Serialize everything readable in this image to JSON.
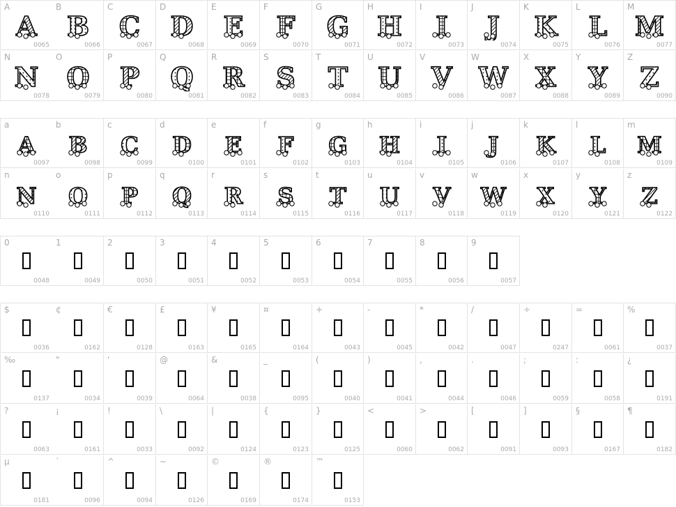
{
  "sections": [
    {
      "id": "uppercase",
      "glyph": "letter",
      "cells": [
        [
          "A",
          "0065"
        ],
        [
          "B",
          "0066"
        ],
        [
          "C",
          "0067"
        ],
        [
          "D",
          "0068"
        ],
        [
          "E",
          "0069"
        ],
        [
          "F",
          "0070"
        ],
        [
          "G",
          "0071"
        ],
        [
          "H",
          "0072"
        ],
        [
          "I",
          "0073"
        ],
        [
          "J",
          "0074"
        ],
        [
          "K",
          "0075"
        ],
        [
          "L",
          "0076"
        ],
        [
          "M",
          "0077"
        ],
        [
          "N",
          "0078"
        ],
        [
          "O",
          "0079"
        ],
        [
          "P",
          "0080"
        ],
        [
          "Q",
          "0081"
        ],
        [
          "R",
          "0082"
        ],
        [
          "S",
          "0083"
        ],
        [
          "T",
          "0084"
        ],
        [
          "U",
          "0085"
        ],
        [
          "V",
          "0086"
        ],
        [
          "W",
          "0087"
        ],
        [
          "X",
          "0088"
        ],
        [
          "Y",
          "0089"
        ],
        [
          "Z",
          "0090"
        ]
      ]
    },
    {
      "id": "lowercase",
      "glyph": "letter",
      "cells": [
        [
          "a",
          "0097"
        ],
        [
          "b",
          "0098"
        ],
        [
          "c",
          "0099"
        ],
        [
          "d",
          "0100"
        ],
        [
          "e",
          "0101"
        ],
        [
          "f",
          "0102"
        ],
        [
          "g",
          "0103"
        ],
        [
          "h",
          "0104"
        ],
        [
          "i",
          "0105"
        ],
        [
          "j",
          "0106"
        ],
        [
          "k",
          "0107"
        ],
        [
          "l",
          "0108"
        ],
        [
          "m",
          "0109"
        ],
        [
          "n",
          "0110"
        ],
        [
          "o",
          "0111"
        ],
        [
          "p",
          "0112"
        ],
        [
          "q",
          "0113"
        ],
        [
          "r",
          "0114"
        ],
        [
          "s",
          "0115"
        ],
        [
          "t",
          "0116"
        ],
        [
          "u",
          "0117"
        ],
        [
          "v",
          "0118"
        ],
        [
          "w",
          "0119"
        ],
        [
          "x",
          "0120"
        ],
        [
          "y",
          "0121"
        ],
        [
          "z",
          "0122"
        ]
      ]
    },
    {
      "id": "digits",
      "glyph": "box",
      "cells": [
        [
          "0",
          "0048"
        ],
        [
          "1",
          "0049"
        ],
        [
          "2",
          "0050"
        ],
        [
          "3",
          "0051"
        ],
        [
          "4",
          "0052"
        ],
        [
          "5",
          "0053"
        ],
        [
          "6",
          "0054"
        ],
        [
          "7",
          "0055"
        ],
        [
          "8",
          "0056"
        ],
        [
          "9",
          "0057"
        ]
      ]
    },
    {
      "id": "symbols",
      "glyph": "box",
      "cells": [
        [
          "$",
          "0036"
        ],
        [
          "¢",
          "0162"
        ],
        [
          "€",
          "0128"
        ],
        [
          "£",
          "0163"
        ],
        [
          "¥",
          "0165"
        ],
        [
          "¤",
          "0164"
        ],
        [
          "+",
          "0043"
        ],
        [
          "-",
          "0045"
        ],
        [
          "*",
          "0042"
        ],
        [
          "/",
          "0047"
        ],
        [
          "÷",
          "0247"
        ],
        [
          "=",
          "0061"
        ],
        [
          "%",
          "0037"
        ],
        [
          "‰",
          "0137"
        ],
        [
          "\"",
          "0034"
        ],
        [
          "'",
          "0039"
        ],
        [
          "@",
          "0064"
        ],
        [
          "&",
          "0038"
        ],
        [
          "_",
          "0095"
        ],
        [
          "(",
          "0040"
        ],
        [
          ")",
          "0041"
        ],
        [
          ",",
          "0044"
        ],
        [
          ".",
          "0046"
        ],
        [
          ";",
          "0059"
        ],
        [
          ":",
          "0058"
        ],
        [
          "¿",
          "0191"
        ],
        [
          "?",
          "0063"
        ],
        [
          "¡",
          "0161"
        ],
        [
          "!",
          "0033"
        ],
        [
          "\\",
          "0092"
        ],
        [
          "|",
          "0124"
        ],
        [
          "{",
          "0123"
        ],
        [
          "}",
          "0125"
        ],
        [
          "<",
          "0060"
        ],
        [
          ">",
          "0062"
        ],
        [
          "[",
          "0091"
        ],
        [
          "]",
          "0093"
        ],
        [
          "§",
          "0167"
        ],
        [
          "¶",
          "0182"
        ],
        [
          "µ",
          "0181"
        ],
        [
          "`",
          "0096"
        ],
        [
          "^",
          "0094"
        ],
        [
          "~",
          "0126"
        ],
        [
          "©",
          "0169"
        ],
        [
          "®",
          "0174"
        ],
        [
          "™",
          "0153"
        ]
      ]
    }
  ]
}
